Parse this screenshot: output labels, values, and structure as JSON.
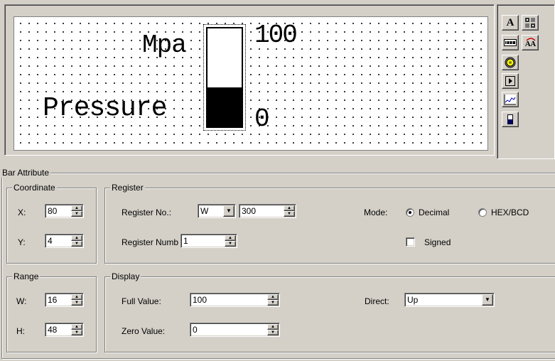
{
  "preview": {
    "unit_text": "Mpa",
    "label_text": "Pressure",
    "max_text": "100",
    "min_text": "0",
    "fill_fraction": 0.4
  },
  "toolbox": {
    "icons": [
      "text-icon",
      "bitmap-icon",
      "numeric-display-icon",
      "text-toggle-icon",
      "lamp-icon",
      "button-icon",
      "trend-chart-icon",
      "bar-icon"
    ],
    "text_button_glyph": "A",
    "toggle_button_glyph": "A A"
  },
  "bar_attribute": {
    "title": "Bar Attribute",
    "coordinate": {
      "title": "Coordinate",
      "x_label": "X:",
      "x_value": "80",
      "y_label": "Y:",
      "y_value": "4"
    },
    "register": {
      "title": "Register",
      "register_no_label": "Register No.:",
      "register_type": "W",
      "register_no_value": "300",
      "register_number_label": "Register Numb",
      "register_number_value": "1",
      "mode_label": "Mode:",
      "mode_decimal_label": "Decimal",
      "mode_hex_label": "HEX/BCD",
      "mode_selected": "Decimal",
      "signed_label": "Signed",
      "signed_checked": false
    },
    "range": {
      "title": "Range",
      "w_label": "W:",
      "w_value": "16",
      "h_label": "H:",
      "h_value": "48"
    },
    "display": {
      "title": "Display",
      "full_value_label": "Full Value:",
      "full_value": "100",
      "zero_value_label": "Zero Value:",
      "zero_value": "0",
      "direct_label": "Direct:",
      "direct_value": "Up"
    }
  }
}
